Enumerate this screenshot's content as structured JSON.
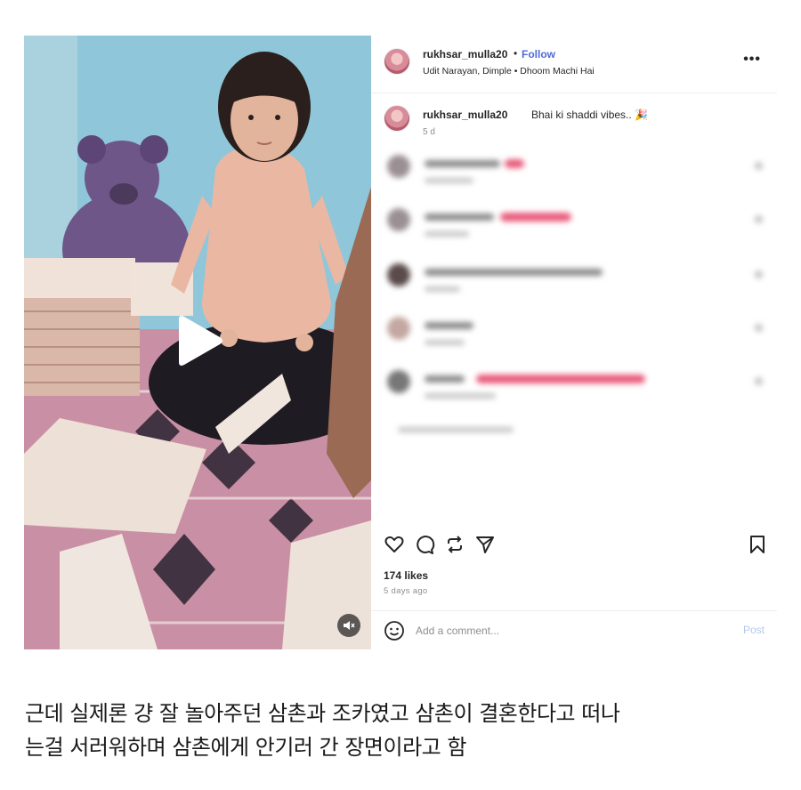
{
  "post": {
    "username": "rukhsar_mulla20",
    "separator": "•",
    "follow_label": "Follow",
    "audio": "Udit Narayan, Dimple • Dhoom Machi Hai",
    "more_label": "•••",
    "caption": {
      "username": "rukhsar_mulla20",
      "text": "Bhai ki shaddi vibes.. 🎉",
      "time": "5 d"
    },
    "comments_blurred": [
      {
        "name_bar": 85,
        "hearts": 2
      },
      {
        "name_bar": 78,
        "hearts": 5
      },
      {
        "name_bar": 200,
        "hearts": 0
      },
      {
        "name_bar": 55,
        "hearts": 0
      },
      {
        "name_bar": 45,
        "hearts": 11
      }
    ],
    "icons": {
      "like": "heart-icon",
      "comment": "comment-icon",
      "repost": "repost-icon",
      "share": "share-icon",
      "save": "bookmark-icon",
      "play": "play-icon",
      "mute": "speaker-muted-icon",
      "emoji": "emoji-icon"
    },
    "likes": "174 likes",
    "posted_ago": "5 days ago",
    "comment_placeholder": "Add a comment...",
    "post_label": "Post"
  },
  "colors": {
    "follow_blue": "#4f6bd6",
    "post_disabled": "#b3c8ec",
    "heart_pink": "#e85a7a"
  },
  "caption_below": {
    "line1": "근데 실제론 걍 잘 놀아주던 삼촌과 조카였고 삼촌이 결혼한다고 떠나",
    "line2": "는걸 서러워하며 삼촌에게 안기러 간 장면이라고 함"
  }
}
